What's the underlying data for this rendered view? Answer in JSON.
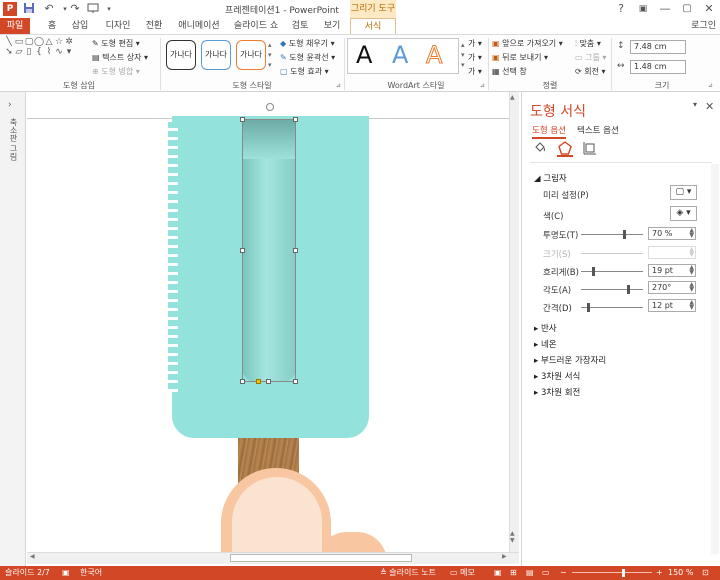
{
  "titlebar": {
    "doc_title": "프레젠테이션1 - PowerPoint",
    "context_tool": "그리기 도구",
    "app_logo": "P",
    "buttons": {
      "help": "?",
      "ribbon_opts": "▣",
      "minimize": "—",
      "restore": "▢",
      "close": "✕"
    },
    "qat": {
      "save": "💾",
      "undo": "↶",
      "redo": "↷",
      "more": "▾"
    }
  },
  "tabs": {
    "file": "파일",
    "items": [
      "홈",
      "삽입",
      "디자인",
      "전환",
      "애니메이션",
      "슬라이드 쇼",
      "검토",
      "보기"
    ],
    "format": "서식",
    "signin": "로그인"
  },
  "ribbon": {
    "insert_shapes": {
      "label": "도형 삽입",
      "edit_shape": "도형 편집",
      "text_box": "텍스트 상자",
      "merge_shapes": "도형 병합"
    },
    "shape_styles": {
      "label": "도형 스타일",
      "preset_text": "가나다",
      "fill": "도형 채우기",
      "outline": "도형 윤곽선",
      "effects": "도형 효과"
    },
    "wordart_styles": {
      "label": "WordArt 스타일",
      "letter": "A",
      "text_fill": "가",
      "text_outline": "가",
      "text_effect": "가"
    },
    "arrange": {
      "label": "정렬",
      "bring_forward": "앞으로 가져오기",
      "send_backward": "뒤로 보내기",
      "selection_pane": "선택 창",
      "align": "맞춤",
      "group": "그룹",
      "rotate": "회전"
    },
    "size": {
      "label": "크기",
      "height": "7.48 cm",
      "width": "1.48 cm"
    }
  },
  "thumbstrip": {
    "label": "축소판 그림"
  },
  "pane": {
    "title": "도형 서식",
    "tab_shape": "도형 옵션",
    "tab_text": "텍스트 옵션",
    "section_shadow": "그림자",
    "props": {
      "preset": "미리 설정(P)",
      "color": "색(C)",
      "transparency": "투명도(T)",
      "transparency_value": "70 %",
      "size": "크기(S)",
      "size_value": "",
      "blur": "흐리게(B)",
      "blur_value": "19 pt",
      "angle": "각도(A)",
      "angle_value": "270°",
      "distance": "간격(D)",
      "distance_value": "12 pt"
    },
    "collapsed_sections": [
      "반사",
      "네온",
      "부드러운 가장자리",
      "3차원 서식",
      "3차원 회전"
    ],
    "controls": {
      "pin": "▾",
      "close": "✕"
    }
  },
  "statusbar": {
    "slide": "슬라이드 2/7",
    "language": "한국어",
    "notes": "슬라이드 노트",
    "comments": "메모",
    "zoom": "150 %"
  },
  "sliders": {
    "transparency": 0.7,
    "blur": 0.19,
    "angle": 0.75,
    "distance": 0.12
  },
  "colors": {
    "accent": "#d24726",
    "popsicle": "#93e2dc",
    "stick": "#b07a48",
    "hand": "#f8c7a2"
  }
}
